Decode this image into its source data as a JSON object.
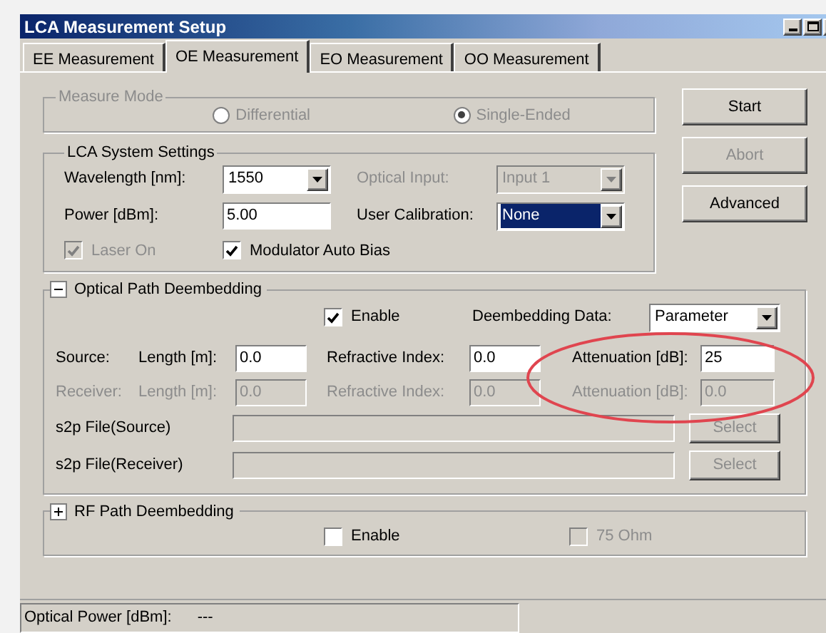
{
  "window": {
    "title": "LCA Measurement Setup"
  },
  "tabs": [
    {
      "label": "EE Measurement",
      "selected": false
    },
    {
      "label": "OE Measurement",
      "selected": true
    },
    {
      "label": "EO Measurement",
      "selected": false
    },
    {
      "label": "OO Measurement",
      "selected": false
    }
  ],
  "measure_mode": {
    "label": "Measure Mode",
    "disabled": true,
    "options": [
      {
        "label": "Differential",
        "selected": false
      },
      {
        "label": "Single-Ended",
        "selected": true
      }
    ]
  },
  "system_settings": {
    "label": "LCA System Settings",
    "rows": [
      [
        {
          "label": "Wavelength [nm]:",
          "kind": "dropdown",
          "value": "1550",
          "disabled": false
        },
        {
          "label": "Optical Input:",
          "kind": "dropdown",
          "value": "Input 1",
          "disabled": true
        }
      ],
      [
        {
          "label": "Power [dBm]:",
          "kind": "text",
          "value": "5.00",
          "disabled": false
        },
        {
          "label": "User Calibration:",
          "kind": "dropdown",
          "value": "None",
          "disabled": false,
          "highlighted": true
        }
      ]
    ],
    "checkboxes": [
      {
        "label": "Laser On",
        "checked": true,
        "disabled": true
      },
      {
        "label": "Modulator Auto Bias",
        "checked": true,
        "disabled": false
      }
    ]
  },
  "buttons": [
    {
      "label": "Start",
      "disabled": false
    },
    {
      "label": "Abort",
      "disabled": true
    },
    {
      "label": "Advanced",
      "disabled": false
    }
  ],
  "optical_path": {
    "label": "Optical Path Deembedding",
    "expanded": true,
    "enable": {
      "label": "Enable",
      "checked": true
    },
    "data": {
      "label": "Deembedding Data:",
      "value": "Parameter"
    },
    "paths": [
      {
        "name": "Source:",
        "disabled": false,
        "fields": [
          {
            "label": "Length [m]:",
            "value": "0.0"
          },
          {
            "label": "Refractive Index:",
            "value": "0.0"
          },
          {
            "label": "Attenuation [dB]:",
            "value": "25"
          }
        ]
      },
      {
        "name": "Receiver:",
        "disabled": true,
        "fields": [
          {
            "label": "Length [m]:",
            "value": "0.0"
          },
          {
            "label": "Refractive Index:",
            "value": "0.0"
          },
          {
            "label": "Attenuation [dB]:",
            "value": "0.0"
          }
        ]
      }
    ],
    "files": [
      {
        "label": "s2p File(Source)",
        "button": "Select",
        "disabled": true
      },
      {
        "label": "s2p File(Receiver)",
        "button": "Select",
        "disabled": true
      }
    ]
  },
  "rf_path": {
    "label": "RF Path Deembedding",
    "expanded": false,
    "checkboxes": [
      {
        "label": "Enable",
        "checked": false,
        "disabled": false
      },
      {
        "label": "75 Ohm",
        "checked": false,
        "disabled": true
      }
    ]
  },
  "status_bar": {
    "label": "Optical Power [dBm]:",
    "value": "---"
  }
}
